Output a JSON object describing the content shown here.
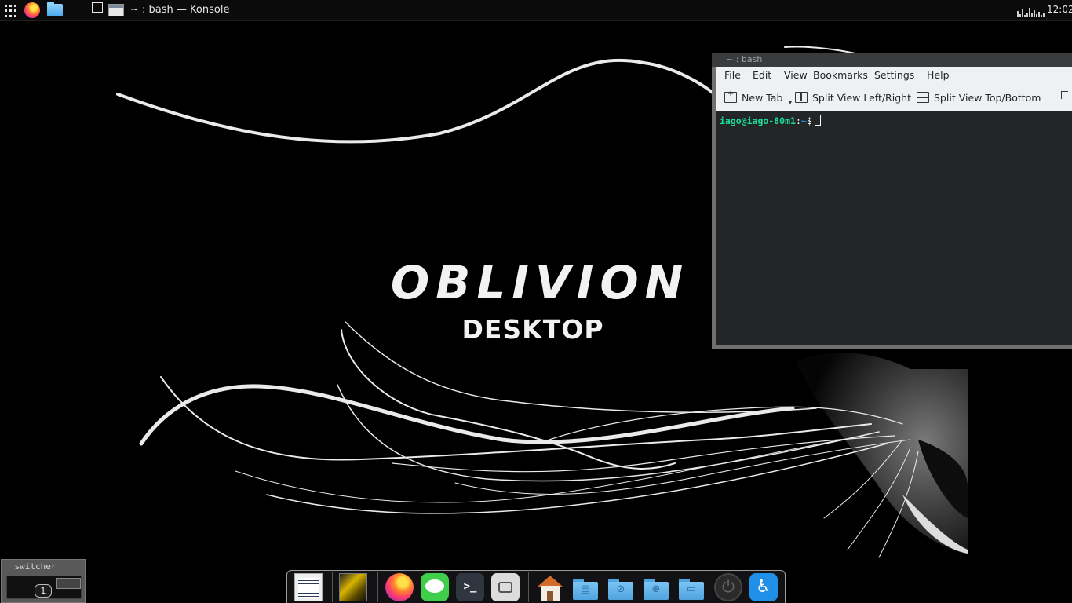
{
  "top_panel": {
    "active_window_title": "~ : bash — Konsole",
    "clock": "12:02",
    "icons": [
      "app-launcher-icon",
      "firefox-icon",
      "file-manager-icon",
      "window-icon",
      "cpu-graph-icon"
    ]
  },
  "wallpaper": {
    "title": "OBLIVION",
    "subtitle": "DESKTOP"
  },
  "konsole": {
    "title": "~ : bash",
    "menu": [
      "File",
      "Edit",
      "View",
      "Bookmarks",
      "Settings",
      "Help"
    ],
    "toolbar": {
      "new_tab": "New Tab",
      "split_lr": "Split View Left/Right",
      "split_tb": "Split View Top/Bottom"
    },
    "prompt": {
      "user_host": "iago@iago-80m1",
      "separator": ":",
      "path": "~",
      "symbol": "$"
    },
    "colors": {
      "user": "#1cdc9a",
      "path": "#1d99f3",
      "terminal_bg": "#232627"
    }
  },
  "switcher": {
    "label": "switcher",
    "desktop_number": "1"
  },
  "dock": {
    "items": [
      "task-manager",
      "wallpaper-preview",
      "firefox",
      "messages",
      "terminal",
      "screenshot",
      "home-folder",
      "documents-folder",
      "network-folder",
      "downloads-folder",
      "desktop-folder",
      "power",
      "accessibility"
    ],
    "terminal_glyph": ">_"
  }
}
